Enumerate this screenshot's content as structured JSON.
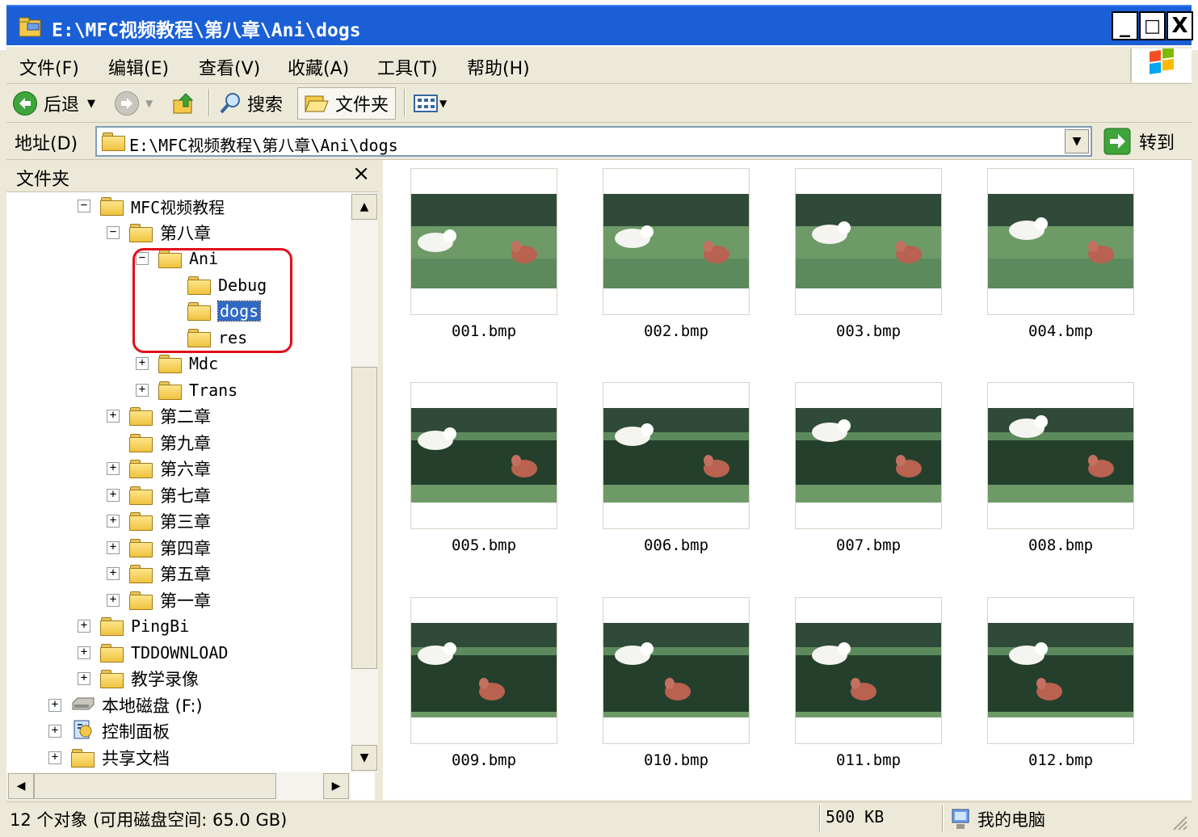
{
  "window": {
    "title": "E:\\MFC视频教程\\第八章\\Ani\\dogs",
    "minimize": "_",
    "maximize": "□",
    "close": "X"
  },
  "menu": [
    "文件(F)",
    "编辑(E)",
    "查看(V)",
    "收藏(A)",
    "工具(T)",
    "帮助(H)"
  ],
  "toolbar": {
    "back": "后退",
    "search": "搜索",
    "folders": "文件夹"
  },
  "address": {
    "label": "地址(D)",
    "path": "E:\\MFC视频教程\\第八章\\Ani\\dogs",
    "go": "转到"
  },
  "folder_pane": {
    "title": "文件夹",
    "close": "×",
    "tree": [
      {
        "label": "MFC视频教程",
        "expander": "−",
        "level": 0
      },
      {
        "label": "第八章",
        "expander": "−",
        "level": 1
      },
      {
        "label": "Ani",
        "expander": "−",
        "level": 2
      },
      {
        "label": "Debug",
        "expander": "",
        "level": 3
      },
      {
        "label": "dogs",
        "expander": "",
        "level": 3,
        "selected": true
      },
      {
        "label": "res",
        "expander": "",
        "level": 3
      },
      {
        "label": "Mdc",
        "expander": "+",
        "level": 2
      },
      {
        "label": "Trans",
        "expander": "+",
        "level": 2
      },
      {
        "label": "第二章",
        "expander": "+",
        "level": 1
      },
      {
        "label": "第九章",
        "expander": "",
        "level": 1
      },
      {
        "label": "第六章",
        "expander": "+",
        "level": 1
      },
      {
        "label": "第七章",
        "expander": "+",
        "level": 1
      },
      {
        "label": "第三章",
        "expander": "+",
        "level": 1
      },
      {
        "label": "第四章",
        "expander": "+",
        "level": 1
      },
      {
        "label": "第五章",
        "expander": "+",
        "level": 1
      },
      {
        "label": "第一章",
        "expander": "+",
        "level": 1
      },
      {
        "label": "PingBi",
        "expander": "+",
        "level": 0
      },
      {
        "label": "TDDOWNLOAD",
        "expander": "+",
        "level": 0
      },
      {
        "label": "教学录像",
        "expander": "+",
        "level": 0
      },
      {
        "label": "本地磁盘 (F:)",
        "expander": "+",
        "level": -1,
        "icon": "drive"
      },
      {
        "label": "控制面板",
        "expander": "+",
        "level": -1,
        "icon": "control-panel"
      },
      {
        "label": "共享文档",
        "expander": "+",
        "level": -1,
        "icon": "folder"
      }
    ]
  },
  "files": [
    {
      "name": "001.bmp"
    },
    {
      "name": "002.bmp"
    },
    {
      "name": "003.bmp"
    },
    {
      "name": "004.bmp"
    },
    {
      "name": "005.bmp"
    },
    {
      "name": "006.bmp"
    },
    {
      "name": "007.bmp"
    },
    {
      "name": "008.bmp"
    },
    {
      "name": "009.bmp"
    },
    {
      "name": "010.bmp"
    },
    {
      "name": "011.bmp"
    },
    {
      "name": "012.bmp"
    }
  ],
  "status": {
    "objects": "12 个对象 (可用磁盘空间: 65.0 GB)",
    "size": "500 KB",
    "location": "我的电脑"
  },
  "colors": {
    "titlebar": "#1a5fd6",
    "selection": "#316ac5",
    "highlight_box": "#e0101a"
  }
}
